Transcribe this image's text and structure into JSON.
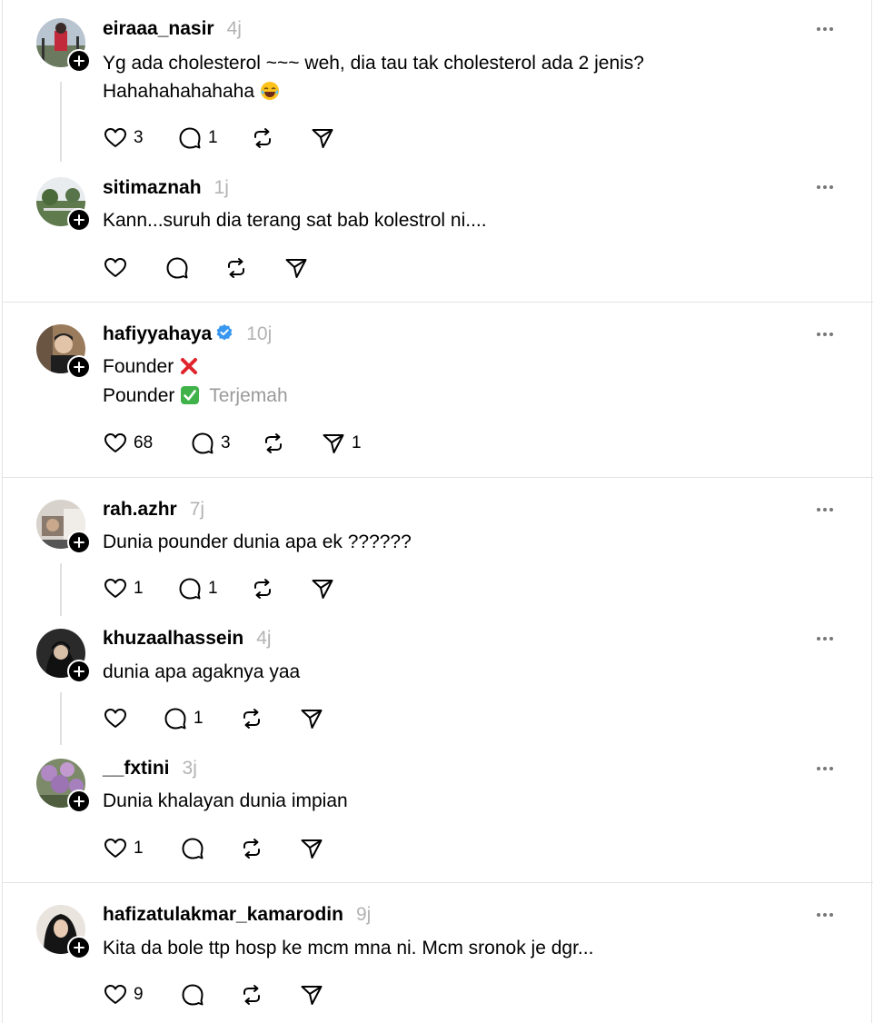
{
  "posts": [
    {
      "username": "eiraaa_nasir",
      "time": "4j",
      "text_lines": [
        "Yg ada cholesterol ~~~ weh, dia tau tak cholesterol ada 2 jenis?",
        "Hahahahahahaha"
      ],
      "likes": "3",
      "replies": "1",
      "reposts": "",
      "shares": ""
    },
    {
      "username": "sitimaznah",
      "time": "1j",
      "text_lines": [
        "Kann...suruh dia terang sat bab kolestrol ni...."
      ],
      "likes": "",
      "replies": "",
      "reposts": "",
      "shares": ""
    },
    {
      "username": "hafiyyahaya",
      "time": "10j",
      "verified": true,
      "text_lines": [
        "Founder",
        "Pounder"
      ],
      "translate_label": "Terjemah",
      "likes": "68",
      "replies": "3",
      "reposts": "",
      "shares": "1"
    },
    {
      "username": "rah.azhr",
      "time": "7j",
      "text_lines": [
        "Dunia pounder dunia apa ek ??????"
      ],
      "likes": "1",
      "replies": "1",
      "reposts": "",
      "shares": ""
    },
    {
      "username": "khuzaalhassein",
      "time": "4j",
      "text_lines": [
        "dunia apa agaknya yaa"
      ],
      "likes": "",
      "replies": "1",
      "reposts": "",
      "shares": ""
    },
    {
      "username": "__fxtini",
      "time": "3j",
      "text_lines": [
        "Dunia khalayan dunia impian"
      ],
      "likes": "1",
      "replies": "",
      "reposts": "",
      "shares": ""
    },
    {
      "username": "hafizatulakmar_kamarodin",
      "time": "9j",
      "text_lines": [
        "Kita da bole ttp hosp ke mcm mna ni. Mcm sronok je dgr..."
      ],
      "likes": "9",
      "replies": "",
      "reposts": "",
      "shares": ""
    }
  ],
  "icons": {
    "like": "heart-icon",
    "reply": "comment-icon",
    "repost": "repost-icon",
    "share": "send-icon",
    "more": "more-icon",
    "follow": "plus-icon",
    "verified": "verified-badge-icon"
  },
  "colors": {
    "verified": "#3897f0",
    "muted": "#b3b3b3",
    "divider": "#e3e3e3"
  }
}
